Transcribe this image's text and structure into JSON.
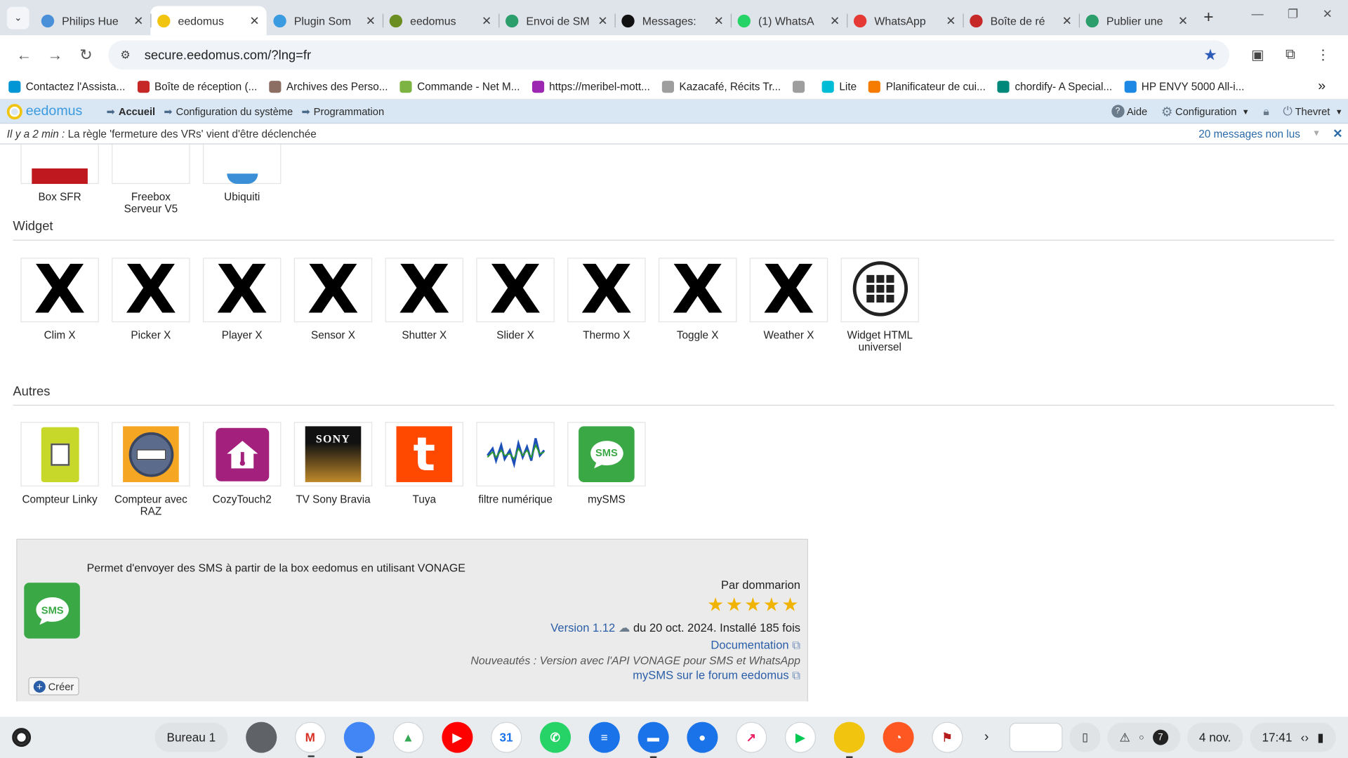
{
  "browser": {
    "tabs": [
      {
        "title": "Philips Hue",
        "color": "#4a90d9"
      },
      {
        "title": "eedomus",
        "color": "#f1c40f",
        "active": true
      },
      {
        "title": "Plugin Som",
        "color": "#3a9be0"
      },
      {
        "title": "eedomus",
        "color": "#6b8e23"
      },
      {
        "title": "Envoi de SM",
        "color": "#2c9e6b"
      },
      {
        "title": "Messages:",
        "color": "#111111"
      },
      {
        "title": "(1) WhatsA",
        "color": "#25d366"
      },
      {
        "title": "WhatsApp",
        "color": "#e53935"
      },
      {
        "title": "Boîte de ré",
        "color": "#c62828"
      },
      {
        "title": "Publier une",
        "color": "#2c9e6b"
      }
    ],
    "url": "secure.eedomus.com/?lng=fr",
    "bookmarks": [
      {
        "label": "Contactez l'Assista...",
        "color": "#0096d6"
      },
      {
        "label": "Boîte de réception (...",
        "color": "#c62828"
      },
      {
        "label": "Archives des Perso...",
        "color": "#8d6e63"
      },
      {
        "label": "Commande - Net M...",
        "color": "#7cb342"
      },
      {
        "label": "https://meribel-mott...",
        "color": "#9c27b0"
      },
      {
        "label": "Kazacafé, Récits Tr...",
        "color": "#9e9e9e"
      },
      {
        "label": "",
        "color": "#9e9e9e"
      },
      {
        "label": "Lite",
        "color": "#00bcd4"
      },
      {
        "label": "Planificateur de cui...",
        "color": "#f57c00"
      },
      {
        "label": "chordify- A Special...",
        "color": "#00897b"
      },
      {
        "label": "HP ENVY 5000 All-i...",
        "color": "#1e88e5"
      }
    ]
  },
  "eedomus": {
    "logo": "eedomus",
    "menu": [
      "Accueil",
      "Configuration du système",
      "Programmation"
    ],
    "right": {
      "help": "Aide",
      "config": "Configuration",
      "user": "Thevret"
    },
    "notif_time": "Il y a 2 min :",
    "notif_text": "La règle 'fermeture des VRs' vient d'être déclenchée",
    "notif_count": "20 messages non lus"
  },
  "top_items": [
    "Box SFR",
    "Freebox Serveur V5",
    "Ubiquiti"
  ],
  "sections": {
    "widget": "Widget",
    "autres": "Autres"
  },
  "widget_items": [
    "Clim X",
    "Picker X",
    "Player X",
    "Sensor X",
    "Shutter X",
    "Slider X",
    "Thermo X",
    "Toggle X",
    "Weather X",
    "Widget HTML universel"
  ],
  "autres_items": [
    {
      "label": "Compteur Linky",
      "icon": "linky-meter-icon"
    },
    {
      "label": "Compteur avec RAZ",
      "icon": "meter-reset-icon"
    },
    {
      "label": "CozyTouch2",
      "icon": "cozytouch-house-icon"
    },
    {
      "label": "TV Sony Bravia",
      "icon": "sony-tv-icon",
      "text": "SONY"
    },
    {
      "label": "Tuya",
      "icon": "tuya-icon",
      "text": "t"
    },
    {
      "label": "filtre numérique",
      "icon": "waveform-icon"
    },
    {
      "label": "mySMS",
      "icon": "sms-bubble-icon",
      "text": "SMS"
    }
  ],
  "detail": {
    "description": "Permet d'envoyer des SMS à partir de la box eedomus en utilisant VONAGE",
    "author": "Par dommarion",
    "rating": 5,
    "stars": "★★★★★",
    "version_link": "Version 1.12",
    "version_info": "du 20 oct. 2024. Installé 185 fois",
    "doc": "Documentation",
    "news": "Nouveautés : Version avec l'API VONAGE pour SMS et WhatsApp",
    "forum": "mySMS sur le forum eedomus",
    "create": "Créer",
    "icon_text": "SMS"
  },
  "shelf": {
    "desk": "Bureau 1",
    "apps": [
      {
        "name": "settings-app-icon",
        "color": "#5f6368"
      },
      {
        "name": "gmail-app-icon",
        "color": "#ffffff",
        "text": "M",
        "fg": "#d93025"
      },
      {
        "name": "chrome-app-icon",
        "color": "#4285f4"
      },
      {
        "name": "drive-app-icon",
        "color": "#ffffff",
        "text": "▲",
        "fg": "#34a853"
      },
      {
        "name": "youtube-app-icon",
        "color": "#ff0000",
        "text": "▶"
      },
      {
        "name": "calendar-app-icon",
        "color": "#ffffff",
        "text": "31",
        "fg": "#1a73e8"
      },
      {
        "name": "whatsapp-app-icon",
        "color": "#25d366",
        "text": "✆"
      },
      {
        "name": "messages-app-icon",
        "color": "#1a73e8",
        "text": "≡"
      },
      {
        "name": "files-app-icon",
        "color": "#1a73e8",
        "text": "▬"
      },
      {
        "name": "contacts-app-icon",
        "color": "#1a73e8",
        "text": "●"
      },
      {
        "name": "shortcut-app-icon",
        "color": "#ffffff",
        "text": "↗",
        "fg": "#e91e63"
      },
      {
        "name": "play-store-app-icon",
        "color": "#ffffff",
        "text": "▶",
        "fg": "#00c853"
      },
      {
        "name": "eedomus-app-icon",
        "color": "#f1c40f"
      },
      {
        "name": "clipchamp-app-icon",
        "color": "#ff5722",
        "text": "◔"
      },
      {
        "name": "flag-app-icon",
        "color": "#ffffff",
        "text": "⚑",
        "fg": "#b71c1c"
      }
    ],
    "date": "4 nov.",
    "time": "17:41",
    "notif_count": "7"
  }
}
